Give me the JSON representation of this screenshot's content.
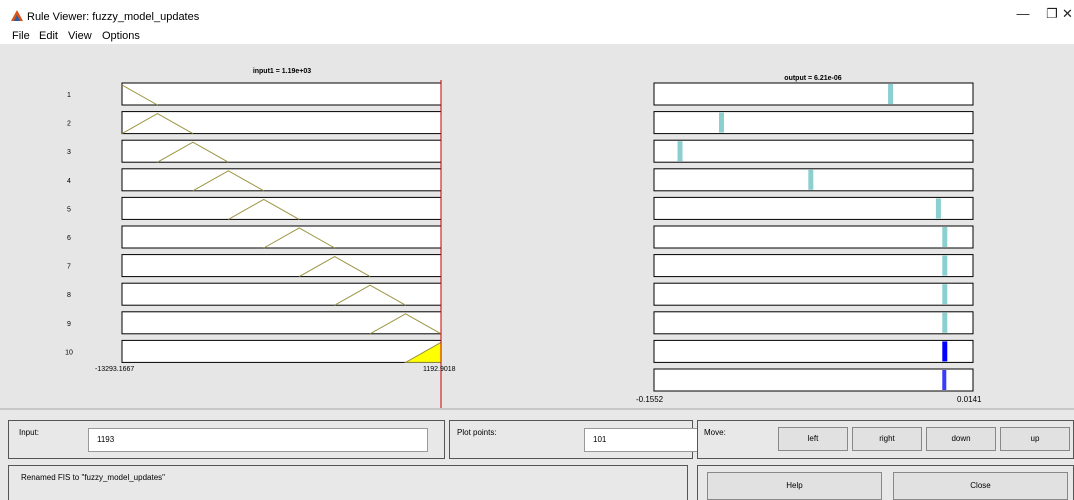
{
  "window": {
    "title": "Rule Viewer: fuzzy_model_updates"
  },
  "window_controls": {
    "minimize": "—",
    "restore": "❐",
    "close": "✕"
  },
  "menu": [
    "File",
    "Edit",
    "View",
    "Options"
  ],
  "colors": {
    "mf_line": "#9a9440",
    "fired": "#ffff00",
    "output_bar": "#8ccfcf",
    "aggregate_bar": "#0000ff",
    "marker": "#cc0000"
  },
  "rule_numbers": [
    "1",
    "2",
    "3",
    "4",
    "5",
    "6",
    "7",
    "8",
    "9",
    "10"
  ],
  "input_plot": {
    "title": "input1 = 1.19e+03",
    "range_min_label": "-13293.1667",
    "range_max_label": "1192.9018"
  },
  "output_plot": {
    "title": "output = 6.21e-06",
    "range_min_label": "-0.1552",
    "range_max_label": "0.0141"
  },
  "output_levels": [
    0.74,
    0.21,
    0.08,
    0.49,
    0.89,
    0.91,
    0.91,
    0.91,
    0.91,
    0.91,
    0.91
  ],
  "controls": {
    "input_label": "Input:",
    "input_value": "1193",
    "plot_points_label": "Plot points:",
    "plot_points_value": "101",
    "move_label": "Move:",
    "left": "left",
    "right": "right",
    "down": "down",
    "up": "up",
    "status": "Renamed FIS to \"fuzzy_model_updates\"",
    "help": "Help",
    "close": "Close"
  }
}
